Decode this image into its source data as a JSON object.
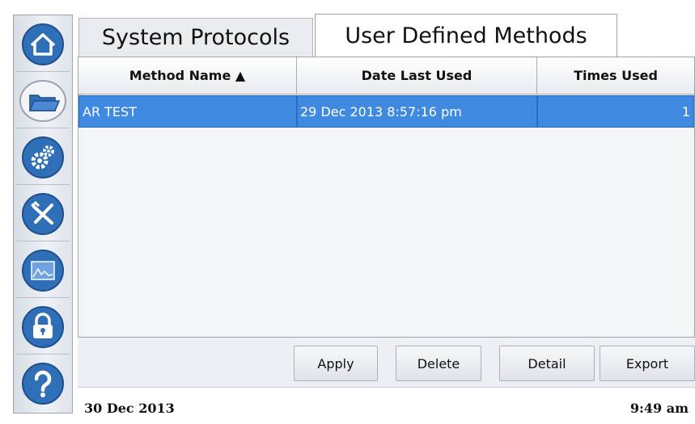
{
  "sidebar": {
    "items": [
      {
        "icon": "home-icon"
      },
      {
        "icon": "folder-icon"
      },
      {
        "icon": "gears-icon"
      },
      {
        "icon": "tools-icon"
      },
      {
        "icon": "chart-icon"
      },
      {
        "icon": "lock-icon"
      },
      {
        "icon": "help-icon"
      }
    ]
  },
  "tabs": [
    {
      "label": "System Protocols",
      "active": false
    },
    {
      "label": "User Defined Methods",
      "active": true
    }
  ],
  "table": {
    "columns": [
      "Method Name ▲",
      "Date Last Used",
      "Times Used"
    ],
    "rows": [
      {
        "name": "AR TEST",
        "date": "29 Dec 2013 8:57:16 pm",
        "times": "1",
        "selected": true
      }
    ]
  },
  "toolbar": {
    "apply_label": "Apply",
    "delete_label": "Delete",
    "detail_label": "Detail",
    "export_label": "Export"
  },
  "status": {
    "date": "30 Dec 2013",
    "time": "9:49 am"
  },
  "colors": {
    "accent": "#3f8ae0",
    "icon_blue": "#2f6fb7"
  }
}
